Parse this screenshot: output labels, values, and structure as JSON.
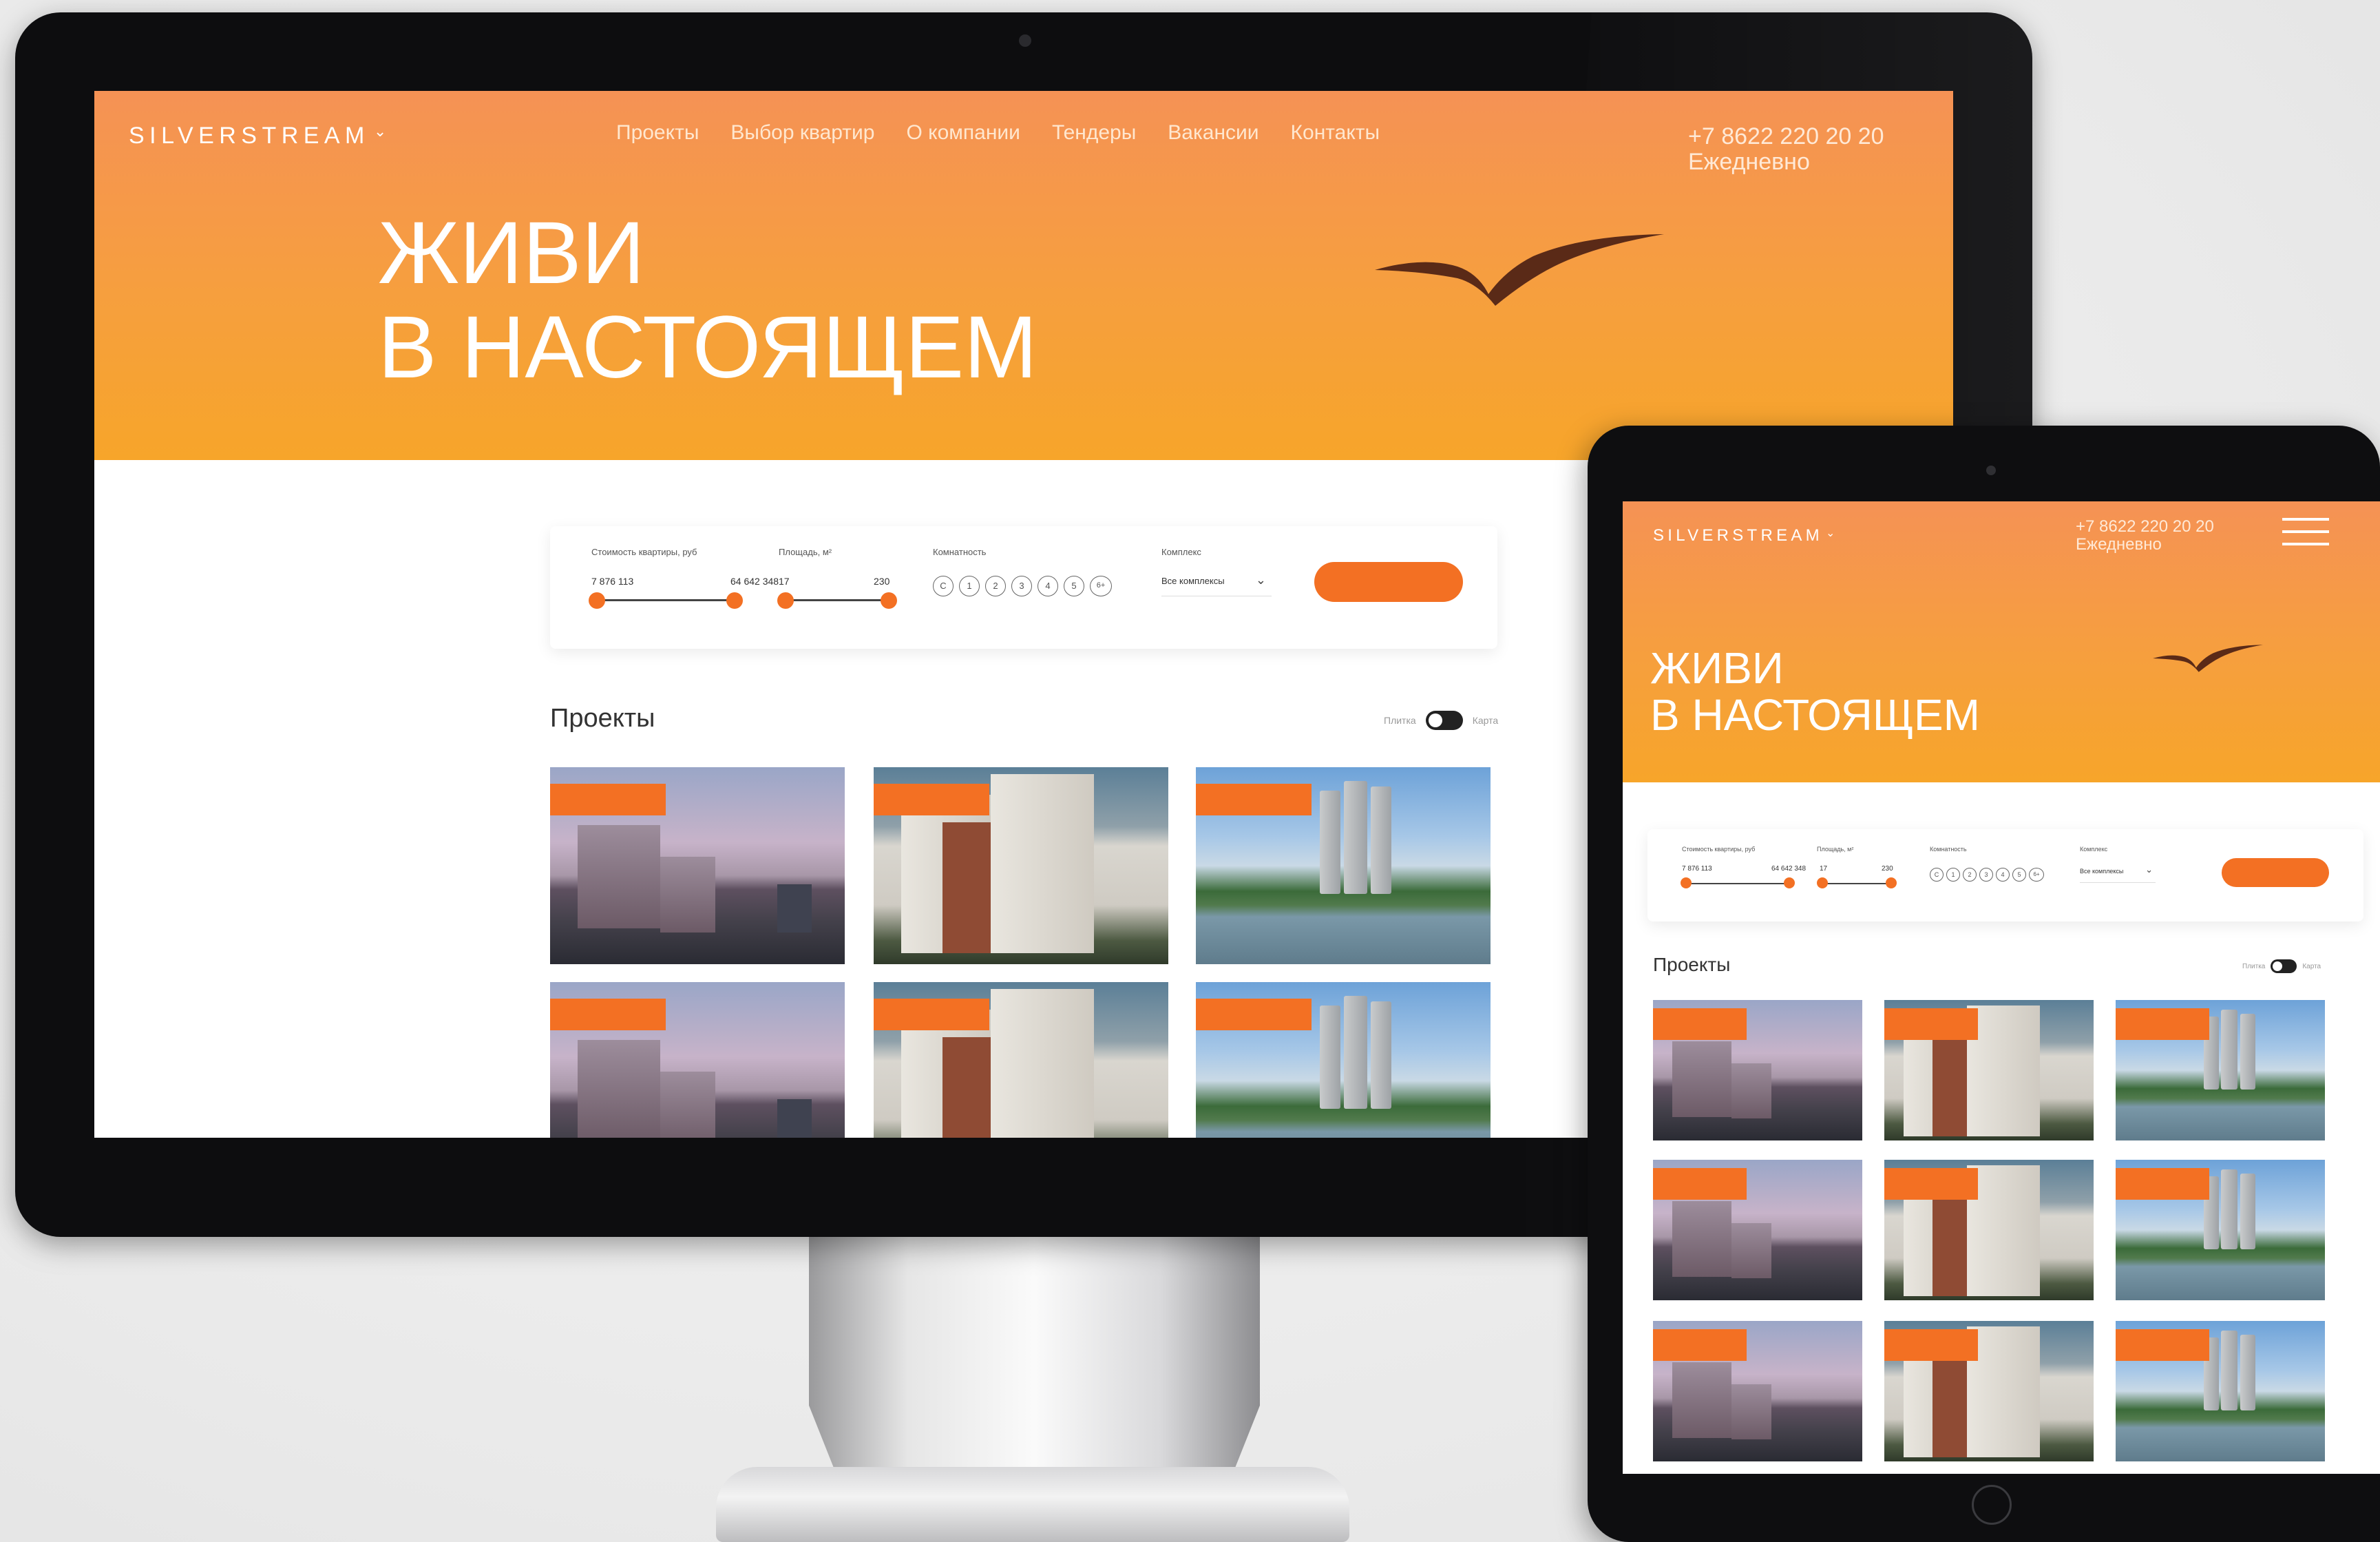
{
  "brand": "SILVERSTREAM",
  "nav": [
    "Проекты",
    "Выбор квартир",
    "О компании",
    "Тендеры",
    "Вакансии",
    "Контакты"
  ],
  "phone": "+7 8622 220 20 20",
  "hours": "Ежедневно",
  "headline": {
    "line1": "ЖИВИ",
    "line2": "В НАСТОЯЩЕМ"
  },
  "filter": {
    "price_label": "Стоимость квартиры, руб",
    "price_min": "7 876 113",
    "price_max": "64 642 348",
    "area_label": "Площадь, м²",
    "area_min": "17",
    "area_max": "230",
    "rooms_label": "Комнатность",
    "rooms": [
      "С",
      "1",
      "2",
      "3",
      "4",
      "5",
      "6+"
    ],
    "complex_label": "Комплекс",
    "complex_value": "Все комплексы"
  },
  "projects": {
    "title": "Проекты",
    "view_tile": "Плитка",
    "view_map": "Карта"
  },
  "colors": {
    "accent": "#f37023",
    "hero_top": "#f59255",
    "hero_bottom": "#f7a52a"
  }
}
